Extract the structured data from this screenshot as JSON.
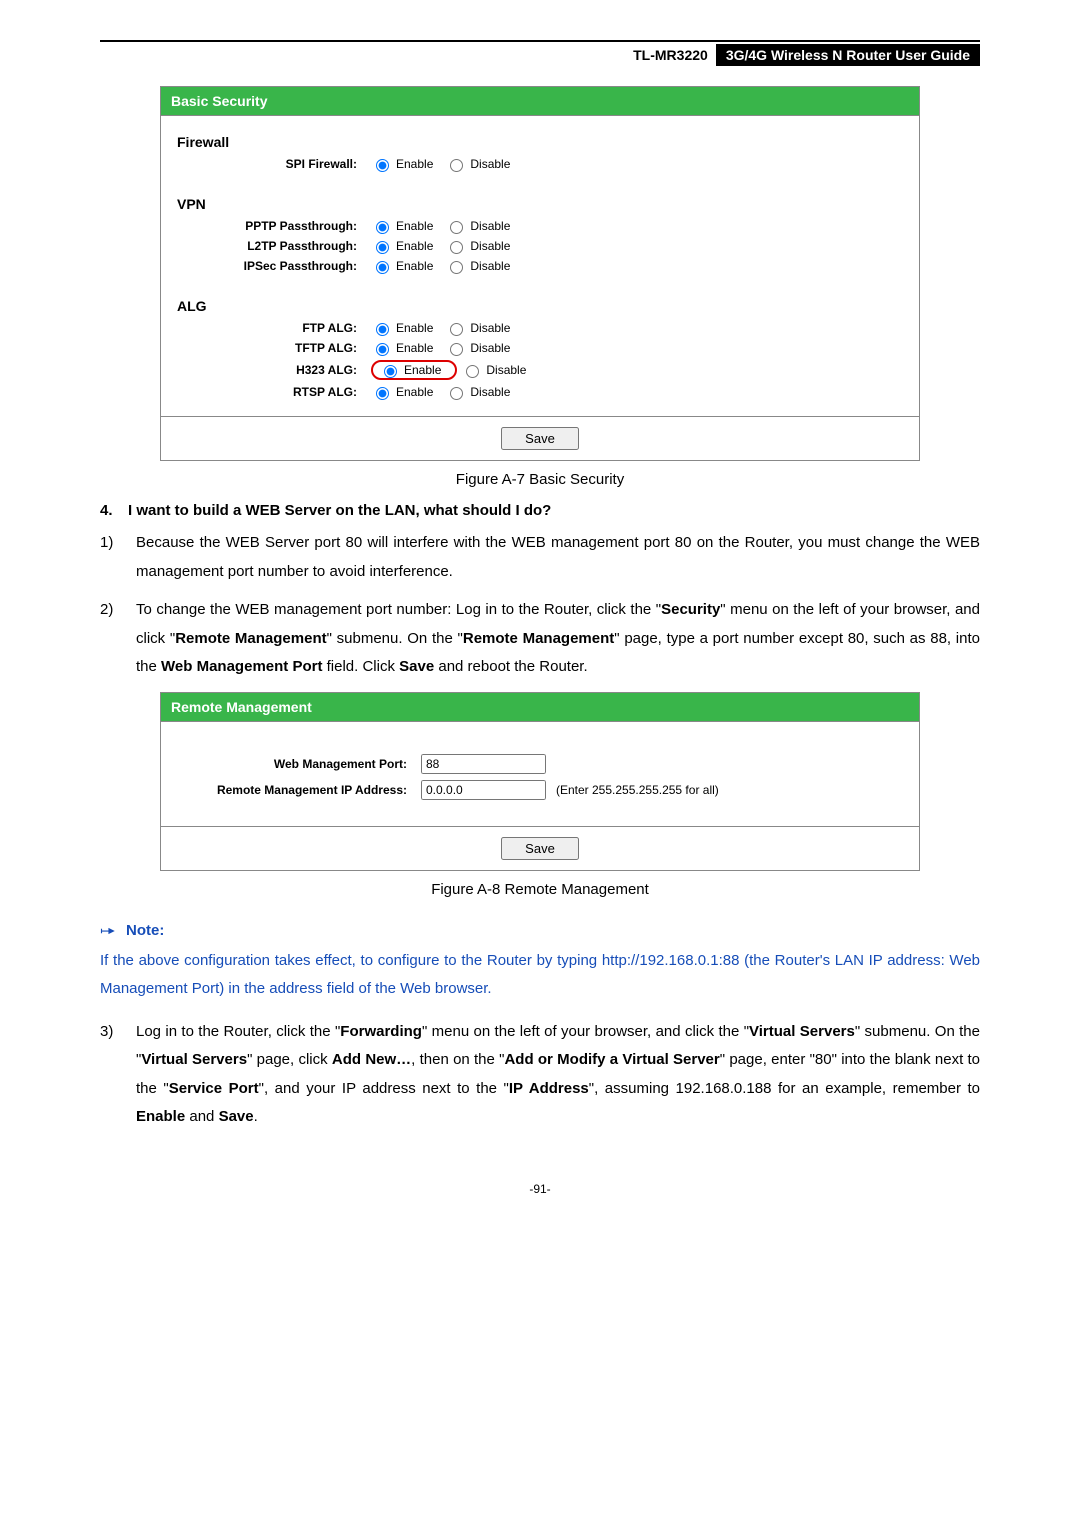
{
  "header": {
    "model": "TL-MR3220",
    "title": "3G/4G Wireless N Router User Guide"
  },
  "panel1": {
    "title": "Basic Security",
    "sections": {
      "firewall": {
        "title": "Firewall",
        "rows": [
          {
            "label": "SPI Firewall:",
            "enable": "Enable",
            "disable": "Disable",
            "selected": "enable",
            "highlight": false
          }
        ]
      },
      "vpn": {
        "title": "VPN",
        "rows": [
          {
            "label": "PPTP Passthrough:",
            "enable": "Enable",
            "disable": "Disable",
            "selected": "enable",
            "highlight": false
          },
          {
            "label": "L2TP Passthrough:",
            "enable": "Enable",
            "disable": "Disable",
            "selected": "enable",
            "highlight": false
          },
          {
            "label": "IPSec Passthrough:",
            "enable": "Enable",
            "disable": "Disable",
            "selected": "enable",
            "highlight": false
          }
        ]
      },
      "alg": {
        "title": "ALG",
        "rows": [
          {
            "label": "FTP ALG:",
            "enable": "Enable",
            "disable": "Disable",
            "selected": "enable",
            "highlight": false
          },
          {
            "label": "TFTP ALG:",
            "enable": "Enable",
            "disable": "Disable",
            "selected": "enable",
            "highlight": false
          },
          {
            "label": "H323 ALG:",
            "enable": "Enable",
            "disable": "Disable",
            "selected": "enable",
            "highlight": true
          },
          {
            "label": "RTSP ALG:",
            "enable": "Enable",
            "disable": "Disable",
            "selected": "enable",
            "highlight": false
          }
        ]
      }
    },
    "save": "Save",
    "caption": "Figure A-7 Basic Security"
  },
  "qa": {
    "num": "4.",
    "text": "I want to build a WEB Server on the LAN, what should I do?"
  },
  "list": {
    "item1": {
      "num": "1)",
      "text": "Because the WEB Server port 80 will interfere with the WEB management port 80 on the Router, you must change the WEB management port number to avoid interference."
    },
    "item2": {
      "num": "2)",
      "pre": "To change the WEB management port number: Log in to the Router, click the \"",
      "b1": "Security",
      "mid1": "\" menu on the left of your browser, and click \"",
      "b2": "Remote Management",
      "mid2": "\" submenu. On the \"",
      "b3": "Remote Management",
      "mid3": "\" page, type a port number except 80, such as 88, into the ",
      "b4": "Web Management Port",
      "mid4": " field. Click ",
      "b5": "Save",
      "post": " and reboot the Router."
    },
    "item3": {
      "num": "3)",
      "pre": "Log in to the Router, click the \"",
      "b1": "Forwarding",
      "mid1": "\" menu on the left of your browser, and click the \"",
      "b2": "Virtual Servers",
      "mid2": "\" submenu. On the \"",
      "b3": "Virtual Servers",
      "mid3": "\" page, click ",
      "b4": "Add New…",
      "mid4": ", then on the \"",
      "b5": "Add or Modify a Virtual Server",
      "mid5": "\" page, enter \"80\" into the blank next to the \"",
      "b6": "Service Port",
      "mid6": "\", and your IP address next to the \"",
      "b7": "IP Address",
      "mid7": "\", assuming 192.168.0.188 for an example, remember to ",
      "b8": "Enable",
      "mid8": " and ",
      "b9": "Save",
      "post": "."
    }
  },
  "panel2": {
    "title": "Remote Management",
    "rows": {
      "port": {
        "label": "Web Management Port:",
        "value": "88"
      },
      "ip": {
        "label": "Remote Management IP Address:",
        "value": "0.0.0.0",
        "hint": "(Enter 255.255.255.255 for all)"
      }
    },
    "save": "Save",
    "caption": "Figure A-8 Remote Management"
  },
  "note": {
    "label": "Note:",
    "body_pre": "If the above configuration takes effect, to configure to the Router by typing ",
    "link": "http://192.168.0.1:88",
    "body_post": " (the Router's LAN IP address: Web Management Port) in the address field of the Web browser."
  },
  "page_num": "-91-"
}
